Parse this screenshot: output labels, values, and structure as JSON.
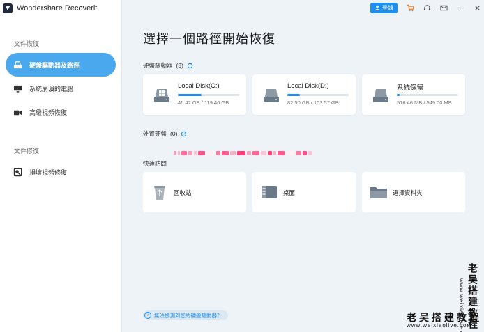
{
  "app": {
    "title": "Wondershare Recoverit"
  },
  "topbar": {
    "login_label": "登錄"
  },
  "sidebar": {
    "sections": [
      {
        "label": "文件恢復"
      },
      {
        "label": "文件修復"
      }
    ],
    "items": [
      {
        "label": "硬盤驅動器及路徑",
        "active": true
      },
      {
        "label": "系統崩潰的電腦"
      },
      {
        "label": "高級視頻恢復"
      },
      {
        "label": "損壞視頻修復"
      }
    ]
  },
  "main": {
    "title": "選擇一個路徑開始恢復",
    "drives_header": {
      "label": "硬盤驅動器",
      "count": "(3)"
    },
    "drives": [
      {
        "name": "Local Disk(C:)",
        "size": "46.42 GB / 119.46 GB",
        "usage": 0.39
      },
      {
        "name": "Local Disk(D:)",
        "size": "82.50 GB / 103.57 GB",
        "usage": 0.2
      },
      {
        "name": "系統保留",
        "size": "516.46 MB / 549.00 MB",
        "usage": 0.05
      }
    ],
    "external_header": {
      "label": "外置硬盤",
      "count": "(0)"
    },
    "quick_header": {
      "label": "快速訪問"
    },
    "quick": [
      {
        "label": "回收站",
        "icon": "recycle-bin-icon"
      },
      {
        "label": "桌面",
        "icon": "desktop-icon"
      },
      {
        "label": "選擇資料夾",
        "icon": "folder-icon"
      }
    ],
    "help_link": "無法檢測到您的硬盤驅動器？"
  },
  "watermark": {
    "vertical": "老吴搭建教程",
    "vertical_url": "www.weixiaolive.com",
    "horizontal": "老吴搭建教程",
    "horizontal_url": "www.weixiaolive.com"
  },
  "colors": {
    "accent": "#1d8ff0",
    "active_nav": "#4aa8ee",
    "background": "#eef3f8"
  }
}
